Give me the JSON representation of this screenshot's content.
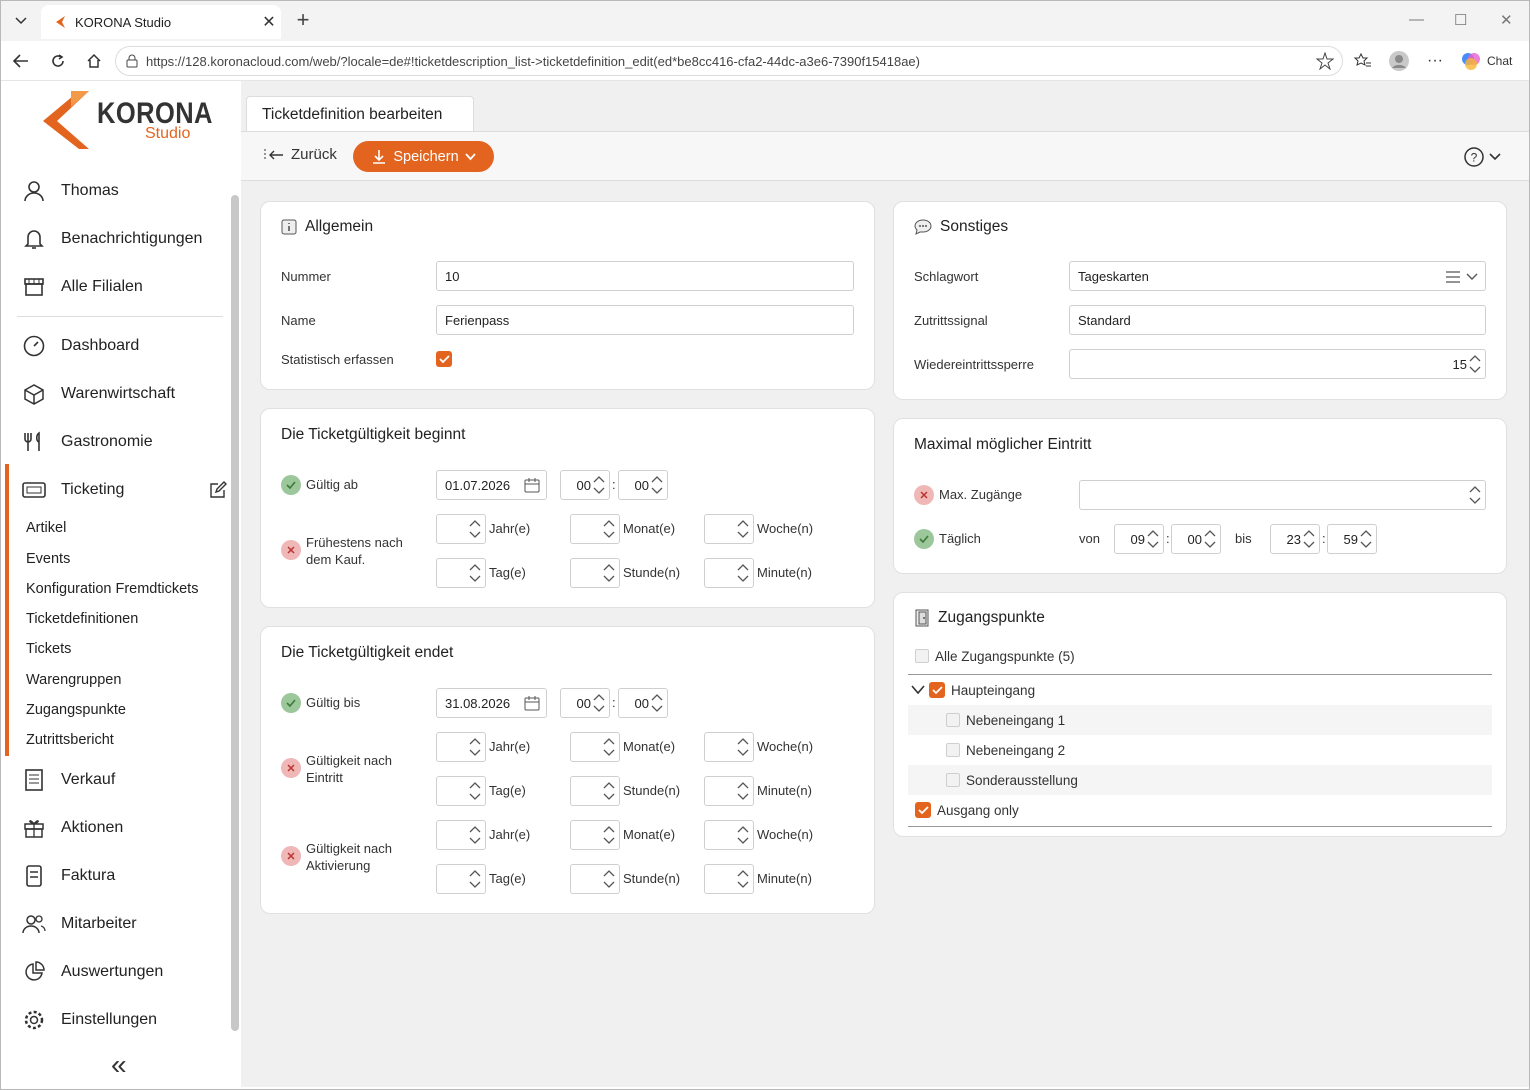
{
  "browser": {
    "tab_title": "KORONA Studio",
    "url": "https://128.koronacloud.com/web/?locale=de#!ticketdescription_list->ticketdefinition_edit(ed*be8cc416-cfa2-44dc-a3e6-7390f15418ae)",
    "chat_label": "Chat"
  },
  "brand": {
    "name": "KORONA",
    "sub": "Studio",
    "accent": "#e3641f"
  },
  "sidebar": {
    "user": "Thomas",
    "top_items": [
      "Benachrichtigungen",
      "Alle Filialen"
    ],
    "items": [
      "Dashboard",
      "Warenwirtschaft",
      "Gastronomie",
      "Ticketing"
    ],
    "ticketing_sub": [
      "Artikel",
      "Events",
      "Konfiguration Fremdtickets",
      "Ticketdefinitionen",
      "Tickets",
      "Warengruppen",
      "Zugangspunkte",
      "Zutrittsbericht"
    ],
    "bottom_items": [
      "Verkauf",
      "Aktionen",
      "Faktura",
      "Mitarbeiter",
      "Auswertungen",
      "Einstellungen"
    ]
  },
  "page": {
    "tab": "Ticketdefinition bearbeiten",
    "back": "Zurück",
    "save": "Speichern"
  },
  "allgemein": {
    "title": "Allgemein",
    "nummer_label": "Nummer",
    "nummer": "10",
    "name_label": "Name",
    "name": "Ferienpass",
    "stat_label": "Statistisch erfassen"
  },
  "beginnt": {
    "title": "Die Ticketgültigkeit beginnt",
    "valid_label": "Gültig ab",
    "date": "01.07.2026",
    "hour": "00",
    "minute": "00",
    "earliest_label": "Frühestens nach dem Kauf.",
    "units": [
      "Jahr(e)",
      "Monat(e)",
      "Woche(n)",
      "Tag(e)",
      "Stunde(n)",
      "Minute(n)"
    ]
  },
  "endet": {
    "title": "Die Ticketgültigkeit endet",
    "valid_label": "Gültig bis",
    "date": "31.08.2026",
    "hour": "00",
    "minute": "00",
    "after_entry_label": "Gültigkeit nach Eintritt",
    "after_activation_label": "Gültigkeit nach Aktivierung"
  },
  "sonstiges": {
    "title": "Sonstiges",
    "schlagwort_label": "Schlagwort",
    "schlagwort": "Tageskarten",
    "signal_label": "Zutrittssignal",
    "signal": "Standard",
    "sperre_label": "Wiedereintrittssperre",
    "sperre": "15"
  },
  "eintritt": {
    "title": "Maximal möglicher Eintritt",
    "max_label": "Max. Zugänge",
    "daily_label": "Täglich",
    "from_label": "von",
    "from_h": "09",
    "from_m": "00",
    "to_label": "bis",
    "to_h": "23",
    "to_m": "59"
  },
  "zugang": {
    "title": "Zugangspunkte",
    "all": "Alle Zugangspunkte (5)",
    "main": "Haupteingang",
    "children": [
      "Nebeneingang 1",
      "Nebeneingang 2",
      "Sonderausstellung"
    ],
    "exit": "Ausgang only"
  }
}
